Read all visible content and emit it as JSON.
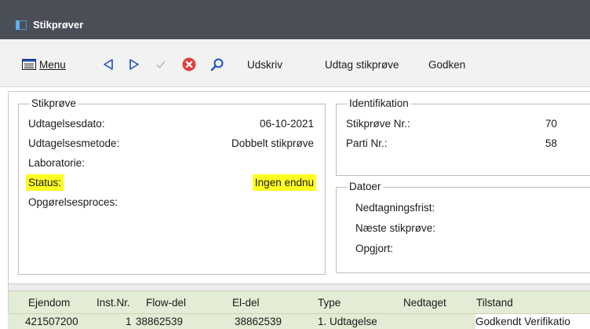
{
  "window": {
    "title": "Stikprøver",
    "icon": "app-window-icon",
    "titlebar_color": "#4a4f57"
  },
  "toolbar": {
    "menu_label": "Menu",
    "menu_underline": "M",
    "menu_icon": "menu-list-icon",
    "back_icon": "triangle-left-icon",
    "forward_icon": "triangle-right-icon",
    "check_icon": "check-icon",
    "cancel_icon": "red-x-circle-icon",
    "search_icon": "magnifier-icon",
    "print_label": "Udskriv",
    "sample_label": "Udtag stikprøve",
    "approve_label": "Godken",
    "accent_blue": "#1a4fbf",
    "cancel_red": "#e0413a"
  },
  "sample": {
    "legend": "Stikprøve",
    "date_label": "Udtagelsesdato:",
    "date_value": "06-10-2021",
    "method_label": "Udtagelsesmetode:",
    "method_value": "Dobbelt stikprøve",
    "lab_label": "Laboratorie:",
    "lab_value": "",
    "status_label": "Status:",
    "status_value": "Ingen endnu",
    "process_label": "Opgørelsesproces:",
    "process_value": "",
    "highlight_color": "#ffff22"
  },
  "identification": {
    "legend": "Identifikation",
    "sample_no_label": "Stikprøve Nr.:",
    "sample_no_value": "70",
    "lot_no_label": "Parti Nr.:",
    "lot_no_value": "58"
  },
  "dates": {
    "legend": "Datoer",
    "reading_deadline_label": "Nedtagningsfrist:",
    "next_sample_label": "Næste stikprøve:",
    "settled_label": "Opgjort:"
  },
  "grid": {
    "header_color": "#e3ecd4",
    "columns": [
      "Ejendom",
      "Inst.Nr.",
      "Flow-del",
      "El-del",
      "Type",
      "Nedtaget",
      "Tilstand"
    ],
    "rows": [
      [
        "421507200",
        "1",
        "38862539",
        "38862539",
        "1. Udtagelse",
        "",
        "Godkendt Verifikatio"
      ]
    ]
  }
}
